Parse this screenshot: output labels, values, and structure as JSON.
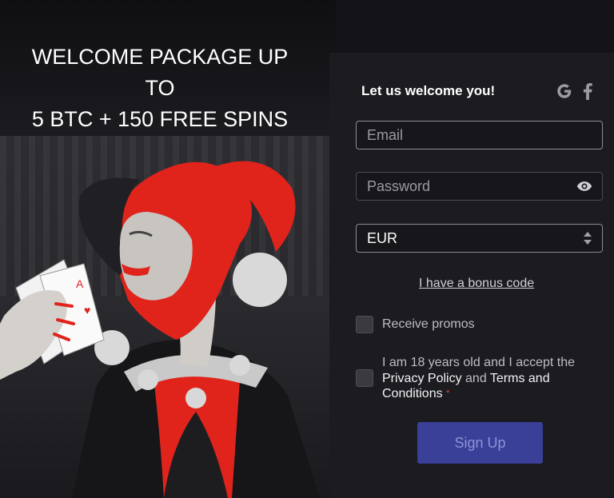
{
  "hero": {
    "line1": "WELCOME PACKAGE UP",
    "line2": "TO",
    "line3": "5 BTC + 150 FREE SPINS"
  },
  "form": {
    "title": "Let us welcome you!",
    "email_placeholder": "Email",
    "password_placeholder": "Password",
    "currency_value": "EUR",
    "bonus_link": "I have a bonus code",
    "promos_label": "Receive promos",
    "age_text_prefix": "I am 18 years old and I accept the",
    "privacy_link": "Privacy Policy",
    "and_text": "and",
    "terms_link": "Terms and Conditions",
    "required_mark": "*",
    "submit_label": "Sign Up"
  },
  "icons": {
    "social": [
      "google-icon",
      "facebook-icon"
    ],
    "password_toggle": "eye-icon",
    "currency_select": "up-down-chevron-icon"
  },
  "colors": {
    "background": "#141418",
    "panel": "#1b1b20",
    "button": "#3a3f98",
    "button_text": "#8e93d6",
    "jester_red": "#e0241c"
  }
}
